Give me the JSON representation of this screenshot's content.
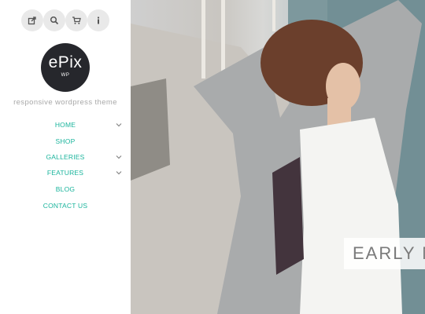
{
  "top_icons": [
    {
      "name": "share-icon"
    },
    {
      "name": "search-icon"
    },
    {
      "name": "cart-icon"
    },
    {
      "name": "info-icon"
    }
  ],
  "logo": {
    "main": "ePix",
    "sub": "WP"
  },
  "tagline": "responsive wordpress theme",
  "nav": [
    {
      "label": "HOME",
      "has_submenu": true
    },
    {
      "label": "SHOP",
      "has_submenu": false
    },
    {
      "label": "GALLERIES",
      "has_submenu": true
    },
    {
      "label": "FEATURES",
      "has_submenu": true
    },
    {
      "label": "BLOG",
      "has_submenu": false
    },
    {
      "label": "CONTACT US",
      "has_submenu": false
    }
  ],
  "hero": {
    "caption": "EARLY M"
  },
  "colors": {
    "accent": "#1ab49c",
    "logo_bg": "#26272c",
    "icon_bg": "#e9e9e9"
  }
}
